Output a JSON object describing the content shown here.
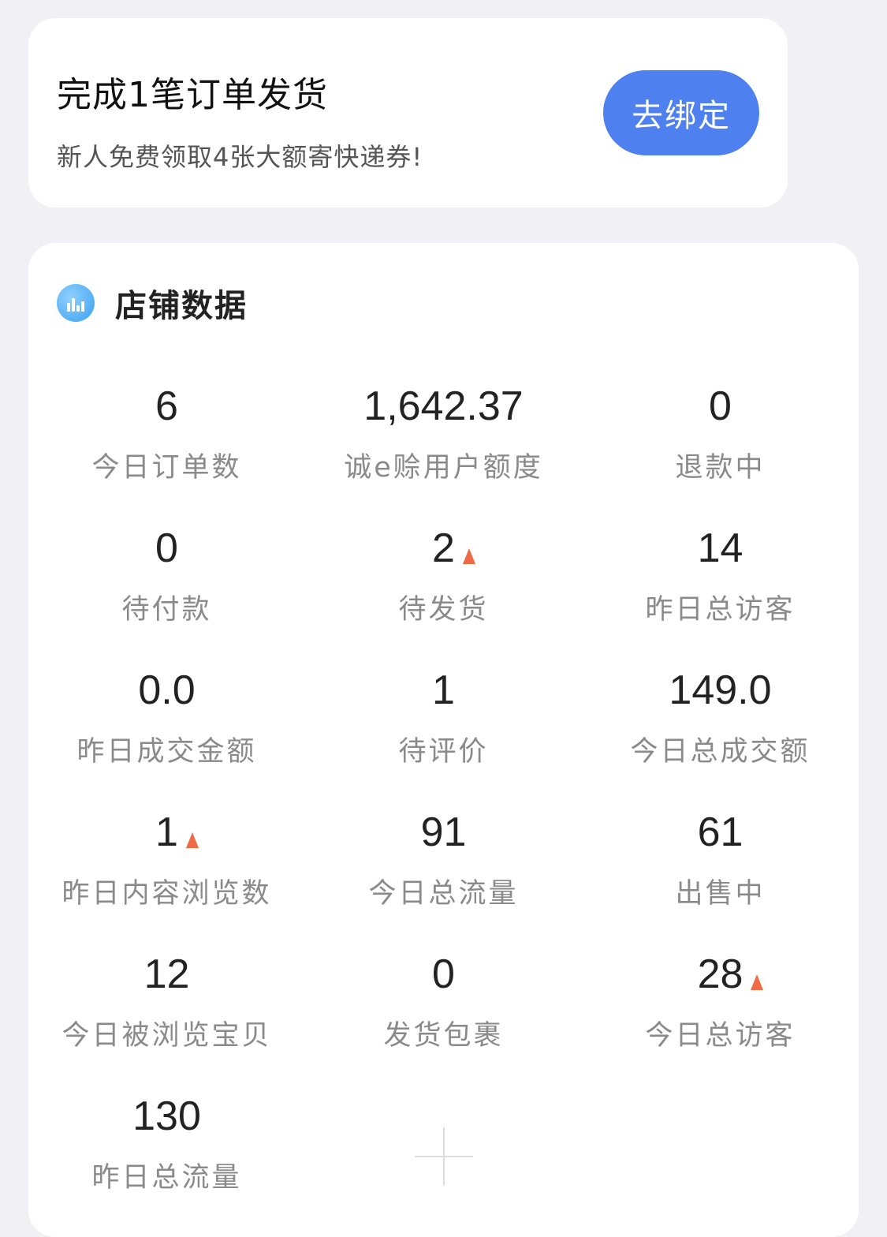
{
  "promo": {
    "title": "完成1笔订单发货",
    "subtitle": "新人免费领取4张大额寄快递券!",
    "button_label": "去绑定"
  },
  "store_data": {
    "title": "店铺数据",
    "icon": "bar-chart-icon",
    "stats": [
      {
        "value": "6",
        "label": "今日订单数",
        "up": false
      },
      {
        "value": "1,642.37",
        "label": "诚e赊用户额度",
        "up": false
      },
      {
        "value": "0",
        "label": "退款中",
        "up": false
      },
      {
        "value": "0",
        "label": "待付款",
        "up": false
      },
      {
        "value": "2",
        "label": "待发货",
        "up": true
      },
      {
        "value": "14",
        "label": "昨日总访客",
        "up": false
      },
      {
        "value": "0.0",
        "label": "昨日成交金额",
        "up": false
      },
      {
        "value": "1",
        "label": "待评价",
        "up": false
      },
      {
        "value": "149.0",
        "label": "今日总成交额",
        "up": false
      },
      {
        "value": "1",
        "label": "昨日内容浏览数",
        "up": true
      },
      {
        "value": "91",
        "label": "今日总流量",
        "up": false
      },
      {
        "value": "61",
        "label": "出售中",
        "up": false
      },
      {
        "value": "12",
        "label": "今日被浏览宝贝",
        "up": false
      },
      {
        "value": "0",
        "label": "发货包裹",
        "up": false
      },
      {
        "value": "28",
        "label": "今日总访客",
        "up": true
      },
      {
        "value": "130",
        "label": "昨日总流量",
        "up": false
      }
    ],
    "trend_up_color": "#ef6a45",
    "accent_color": "#4f80f0"
  }
}
